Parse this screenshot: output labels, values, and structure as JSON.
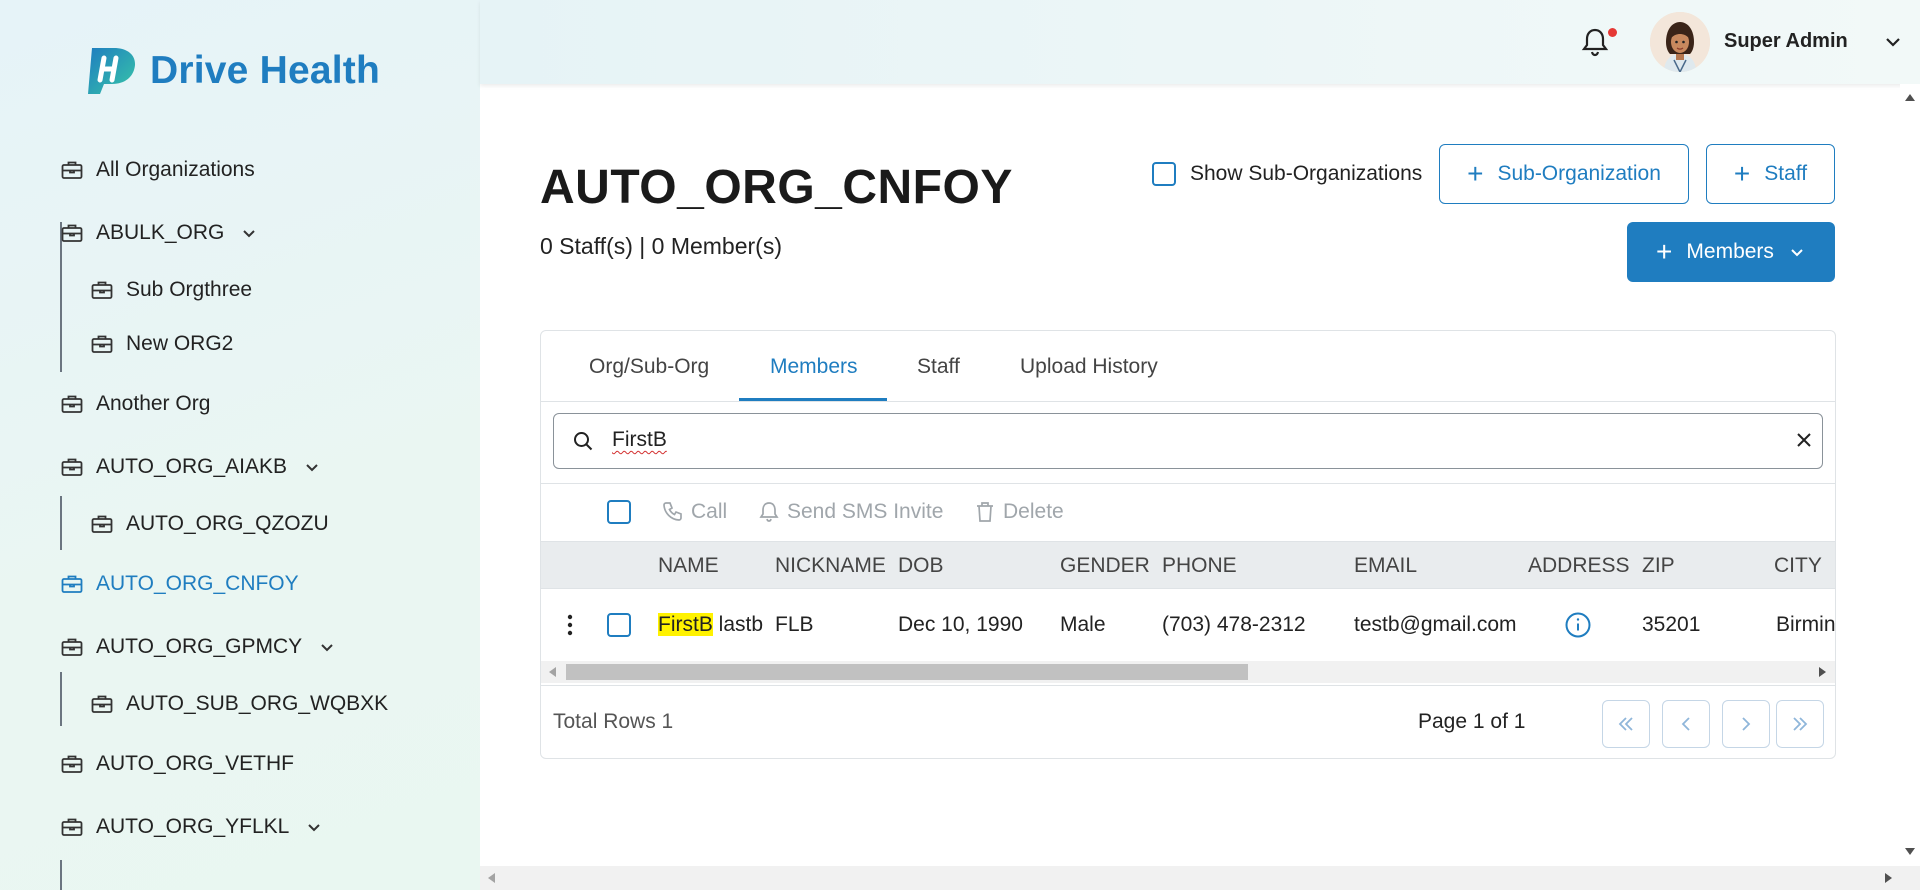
{
  "brand": {
    "name": "Drive Health",
    "accent": "#1f7dc0"
  },
  "header": {
    "user_name": "Super Admin",
    "notification_icon": "bell-icon",
    "has_notification": true
  },
  "sidebar": {
    "items": [
      {
        "label": "All Organizations",
        "icon": "briefcase-icon"
      },
      {
        "label": "ABULK_ORG",
        "icon": "briefcase-icon",
        "expandable": true
      },
      {
        "label": "Sub Orgthree",
        "icon": "briefcase-icon"
      },
      {
        "label": "New ORG2",
        "icon": "briefcase-icon"
      },
      {
        "label": "Another Org",
        "icon": "briefcase-icon"
      },
      {
        "label": "AUTO_ORG_AIAKB",
        "icon": "briefcase-icon",
        "expandable": true
      },
      {
        "label": "AUTO_ORG_QZOZU",
        "icon": "briefcase-icon"
      },
      {
        "label": "AUTO_ORG_CNFOY",
        "icon": "briefcase-icon",
        "active": true
      },
      {
        "label": "AUTO_ORG_GPMCY",
        "icon": "briefcase-icon",
        "expandable": true
      },
      {
        "label": "AUTO_SUB_ORG_WQBXK",
        "icon": "briefcase-icon"
      },
      {
        "label": "AUTO_ORG_VETHF",
        "icon": "briefcase-icon"
      },
      {
        "label": "AUTO_ORG_YFLKL",
        "icon": "briefcase-icon",
        "expandable": true
      }
    ]
  },
  "page": {
    "title": "AUTO_ORG_CNFOY",
    "counts": "0 Staff(s) | 0 Member(s)",
    "show_sub_orgs_label": "Show Sub-Organizations",
    "show_sub_orgs_checked": false,
    "sub_org_button": "Sub-Organization",
    "staff_button": "Staff",
    "members_button": "Members"
  },
  "tabs": [
    {
      "label": "Org/Sub-Org"
    },
    {
      "label": "Members",
      "active": true
    },
    {
      "label": "Staff"
    },
    {
      "label": "Upload History"
    }
  ],
  "search": {
    "value": "FirstB"
  },
  "toolbar": {
    "call": "Call",
    "sms": "Send SMS Invite",
    "delete": "Delete"
  },
  "table": {
    "headers": [
      "NAME",
      "NICKNAME",
      "DOB",
      "GENDER",
      "PHONE",
      "EMAIL",
      "ADDRESS",
      "ZIP",
      "CITY"
    ],
    "rows": [
      {
        "name_highlight": "FirstB",
        "name_rest": " lastb",
        "nickname": "FLB",
        "dob": "Dec 10, 1990",
        "gender": "Male",
        "phone": "(703) 478-2312",
        "email": "testb@gmail.com",
        "address_icon": "info-icon",
        "zip": "35201",
        "city": "Birmingham"
      }
    ]
  },
  "pagination": {
    "total": "Total Rows 1",
    "page_info": "Page 1 of 1"
  }
}
